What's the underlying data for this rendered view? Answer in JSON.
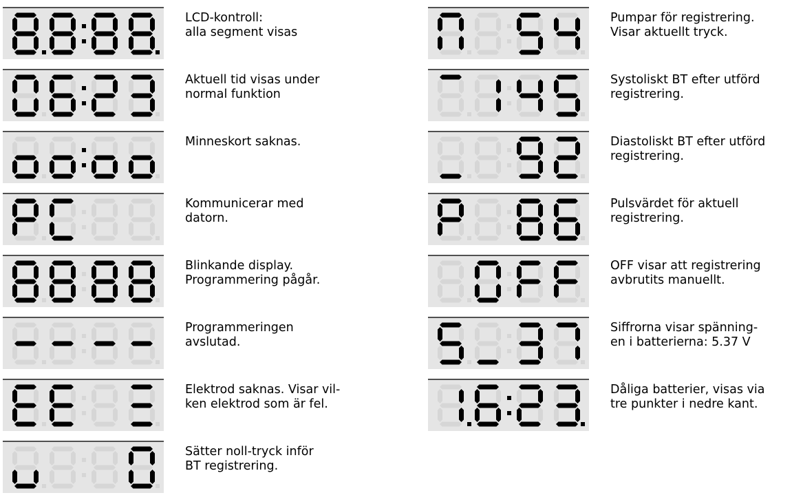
{
  "colors": {
    "segment_on": "#000000",
    "segment_off": "#d6d6d6",
    "panel_bg": "#e5e5e5",
    "divider": "#505050"
  },
  "left_column": [
    {
      "display": [
        "8.",
        "8:",
        "8.",
        "8"
      ],
      "lit": [
        [
          "a",
          "b",
          "c",
          "d",
          "e",
          "f",
          "g"
        ],
        [
          "a",
          "b",
          "c",
          "d",
          "e",
          "f",
          "g"
        ],
        [
          "a",
          "b",
          "c",
          "d",
          "e",
          "f",
          "g"
        ],
        [
          "a",
          "b",
          "c",
          "d",
          "e",
          "f",
          "g"
        ]
      ],
      "dots": [
        "dp1",
        "colon",
        "dp3"
      ],
      "text": "LCD-kontroll:\nalla segment visas"
    },
    {
      "display": [
        "0",
        "6:",
        "2",
        "3"
      ],
      "lit": [
        [
          "a",
          "b",
          "c",
          "d",
          "e",
          "f"
        ],
        [
          "a",
          "c",
          "d",
          "e",
          "f",
          "g"
        ],
        [
          "a",
          "b",
          "d",
          "e",
          "g"
        ],
        [
          "a",
          "b",
          "c",
          "d",
          "g"
        ]
      ],
      "dots": [
        "colon"
      ],
      "text": "Aktuell tid visas under\nnormal funktion"
    },
    {
      "display": [
        "o",
        "o:",
        "o",
        "o"
      ],
      "lit": [
        [
          "c",
          "d",
          "e",
          "g"
        ],
        [
          "c",
          "d",
          "e",
          "g"
        ],
        [
          "c",
          "d",
          "e",
          "g"
        ],
        [
          "c",
          "d",
          "e",
          "g"
        ]
      ],
      "dots": [
        "colon"
      ],
      "text": "Minneskort saknas."
    },
    {
      "display": [
        "P",
        "C",
        "",
        ""
      ],
      "lit": [
        [
          "a",
          "b",
          "e",
          "f",
          "g"
        ],
        [
          "a",
          "d",
          "e",
          "f"
        ],
        [],
        []
      ],
      "dots": [],
      "text": "Kommunicerar med\ndatorn."
    },
    {
      "display": [
        "o",
        "o",
        "o",
        "o"
      ],
      "lit": [
        [
          "a",
          "b",
          "f",
          "g",
          "c",
          "d",
          "e"
        ],
        [
          "a",
          "b",
          "f",
          "g",
          "c",
          "d",
          "e"
        ],
        [
          "a",
          "b",
          "f",
          "g",
          "c",
          "d",
          "e"
        ],
        [
          "a",
          "b",
          "f",
          "g",
          "c",
          "d",
          "e"
        ]
      ],
      "dots": [],
      "text": "Blinkande display.\nProgrammering pågår."
    },
    {
      "display": [
        "-",
        "-",
        "-",
        "-"
      ],
      "lit": [
        [
          "g"
        ],
        [
          "g"
        ],
        [
          "g"
        ],
        [
          "g"
        ]
      ],
      "dots": [],
      "text": "Programmeringen\navslutad."
    },
    {
      "display": [
        "E",
        "E",
        "",
        "≡"
      ],
      "lit": [
        [
          "a",
          "d",
          "e",
          "f",
          "g"
        ],
        [
          "a",
          "d",
          "e",
          "f",
          "g"
        ],
        [],
        [
          "a",
          "d",
          "g"
        ]
      ],
      "dots": [],
      "text": "Elektrod saknas. Visar vil-\nken elektrod som är fel."
    },
    {
      "display": [
        "u",
        "",
        "",
        "0"
      ],
      "lit": [
        [
          "c",
          "d",
          "e"
        ],
        [],
        [],
        [
          "a",
          "b",
          "c",
          "d",
          "e",
          "f"
        ]
      ],
      "dots": [],
      "text": "Sätter noll-tryck inför\nBT registrering."
    }
  ],
  "right_column": [
    {
      "display": [
        "n",
        "",
        "5",
        "4"
      ],
      "lit": [
        [
          "a",
          "b",
          "c",
          "e",
          "f"
        ],
        [],
        [
          "a",
          "c",
          "d",
          "f",
          "g"
        ],
        [
          "b",
          "c",
          "f",
          "g"
        ]
      ],
      "dots": [],
      "text": "Pumpar för registrering.\nVisar aktuellt tryck."
    },
    {
      "display": [
        "‾",
        "1",
        "4",
        "5"
      ],
      "lit": [
        [
          "a"
        ],
        [
          "b",
          "c"
        ],
        [
          "b",
          "c",
          "f",
          "g"
        ],
        [
          "a",
          "c",
          "d",
          "f",
          "g"
        ]
      ],
      "dots": [],
      "text": "Systoliskt BT efter utförd\nregistrering."
    },
    {
      "display": [
        "_",
        "",
        "9",
        "2"
      ],
      "lit": [
        [
          "d"
        ],
        [],
        [
          "a",
          "b",
          "c",
          "d",
          "f",
          "g"
        ],
        [
          "a",
          "b",
          "d",
          "e",
          "g"
        ]
      ],
      "dots": [],
      "text": "Diastoliskt BT efter utförd\nregistrering."
    },
    {
      "display": [
        "P",
        "",
        "8",
        "6"
      ],
      "lit": [
        [
          "a",
          "b",
          "e",
          "f",
          "g"
        ],
        [],
        [
          "a",
          "b",
          "c",
          "d",
          "e",
          "f",
          "g"
        ],
        [
          "a",
          "c",
          "d",
          "e",
          "f",
          "g"
        ]
      ],
      "dots": [],
      "text": "Pulsvärdet för aktuell\nregistrering."
    },
    {
      "display": [
        "",
        "0",
        "F",
        "F"
      ],
      "lit": [
        [],
        [
          "a",
          "b",
          "c",
          "d",
          "e",
          "f"
        ],
        [
          "a",
          "e",
          "f",
          "g"
        ],
        [
          "a",
          "e",
          "f",
          "g"
        ]
      ],
      "dots": [],
      "text": "OFF visar att registrering\navbrutits manuellt."
    },
    {
      "display": [
        "5",
        "_",
        "3",
        "7"
      ],
      "lit": [
        [
          "a",
          "c",
          "d",
          "f",
          "g"
        ],
        [
          "d"
        ],
        [
          "a",
          "b",
          "c",
          "d",
          "g"
        ],
        [
          "a",
          "b",
          "c"
        ]
      ],
      "dots": [],
      "text": "Siffrorna visar spänning-\nen i batterierna: 5.37 V"
    },
    {
      "display": [
        "1.",
        "6:",
        "2.",
        "3"
      ],
      "lit": [
        [
          "b",
          "c"
        ],
        [
          "a",
          "c",
          "d",
          "e",
          "f",
          "g"
        ],
        [
          "a",
          "b",
          "d",
          "e",
          "g"
        ],
        [
          "a",
          "b",
          "c",
          "d",
          "g"
        ]
      ],
      "dots": [
        "dp1",
        "colon",
        "dp3"
      ],
      "text": "Dåliga batterier, visas via\ntre punkter i nedre kant."
    }
  ]
}
